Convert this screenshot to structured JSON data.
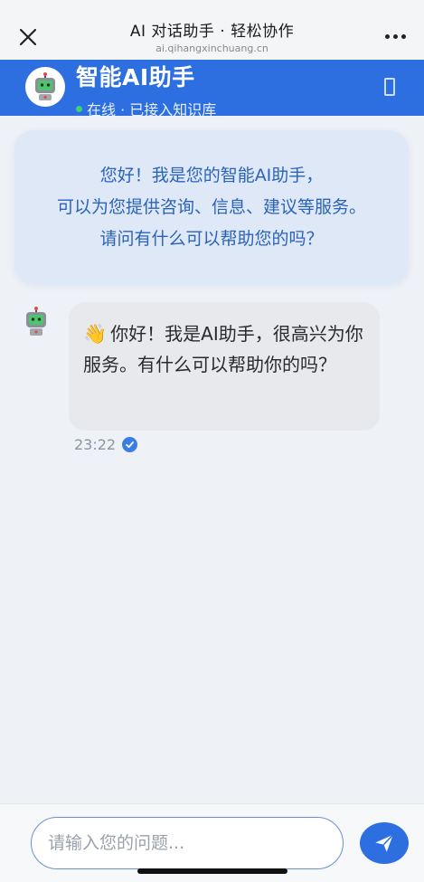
{
  "browser": {
    "title": "AI 对话助手 · 轻松协作",
    "url": "ai.qihangxinchuang.cn"
  },
  "header": {
    "title": "智能AI助手",
    "status": "在线 · 已接入知识库",
    "status_color": "#3fd17a",
    "bg_color": "#2d6fe0"
  },
  "welcome": {
    "lines": [
      "您好！我是您的智能AI助手，",
      "可以为您提供咨询、信息、建议等服务。",
      "请问有什么可以帮助您的吗？"
    ]
  },
  "messages": [
    {
      "sender": "bot",
      "emoji": "👋",
      "text": "你好！我是AI助手，很高兴为你服务。有什么可以帮助你的吗？",
      "time": "23:22"
    }
  ],
  "composer": {
    "placeholder": "请输入您的问题..."
  },
  "icons": {
    "close": "close-icon",
    "more": "more-icon",
    "robot": "robot-icon",
    "send": "send-icon",
    "check": "check-icon"
  }
}
